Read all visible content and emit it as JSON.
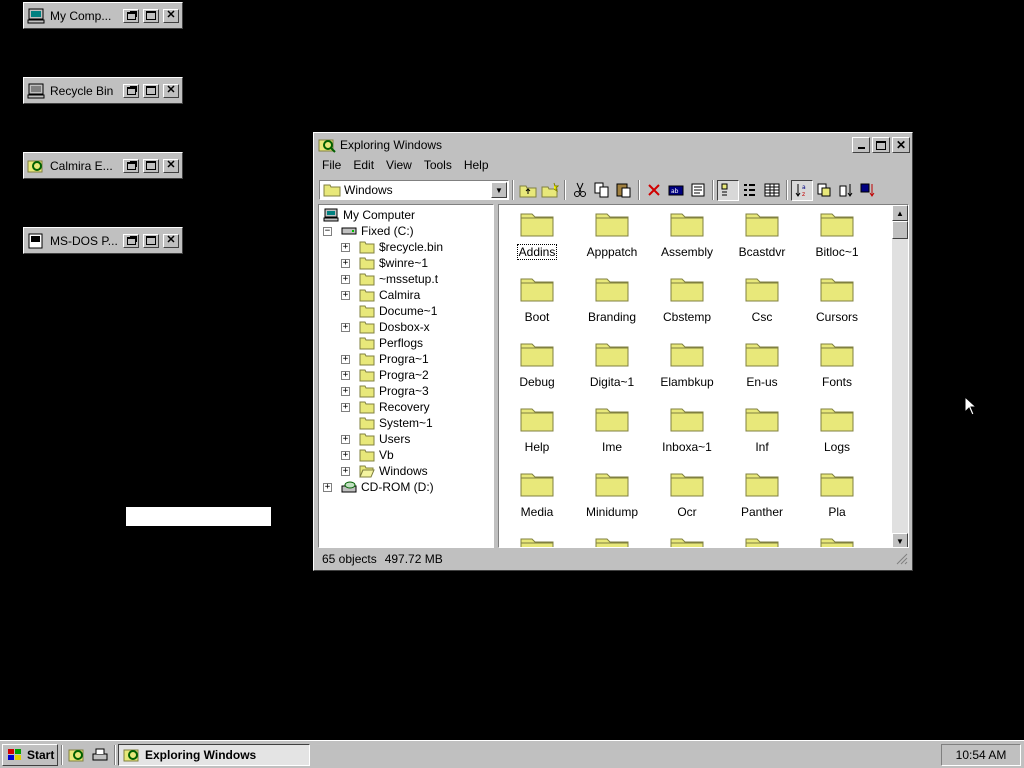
{
  "desktop": {
    "minimized_windows": [
      {
        "title": "My Comp...",
        "icon": "computer-icon"
      },
      {
        "title": "Recycle Bin",
        "icon": "recycle-bin-icon"
      },
      {
        "title": "Calmira E...",
        "icon": "explorer-icon"
      },
      {
        "title": "MS-DOS P...",
        "icon": "msdos-icon"
      }
    ]
  },
  "window": {
    "title": "Exploring Windows",
    "menu": [
      "File",
      "Edit",
      "View",
      "Tools",
      "Help"
    ],
    "location": "Windows",
    "tree": {
      "root": "My Computer",
      "drive": "Fixed (C:)",
      "folders": [
        {
          "name": "$recycle.bin",
          "expandable": true
        },
        {
          "name": "$winre~1",
          "expandable": true
        },
        {
          "name": "~mssetup.t",
          "expandable": true
        },
        {
          "name": "Calmira",
          "expandable": true
        },
        {
          "name": "Docume~1",
          "expandable": false
        },
        {
          "name": "Dosbox-x",
          "expandable": true
        },
        {
          "name": "Perflogs",
          "expandable": false
        },
        {
          "name": "Progra~1",
          "expandable": true
        },
        {
          "name": "Progra~2",
          "expandable": true
        },
        {
          "name": "Progra~3",
          "expandable": true
        },
        {
          "name": "Recovery",
          "expandable": true
        },
        {
          "name": "System~1",
          "expandable": false
        },
        {
          "name": "Users",
          "expandable": true
        },
        {
          "name": "Vb",
          "expandable": true
        },
        {
          "name": "Windows",
          "expandable": true,
          "open": true
        }
      ],
      "cdrom": "CD-ROM (D:)"
    },
    "files": [
      "Addins",
      "Apppatch",
      "Assembly",
      "Bcastdvr",
      "Bitloc~1",
      "Boot",
      "Branding",
      "Cbstemp",
      "Csc",
      "Cursors",
      "Debug",
      "Digita~1",
      "Elambkup",
      "En-us",
      "Fonts",
      "Help",
      "Ime",
      "Inboxa~1",
      "Inf",
      "Logs",
      "Media",
      "Minidump",
      "Ocr",
      "Panther",
      "Pla",
      "",
      "",
      "",
      "",
      ""
    ],
    "status": {
      "objects": "65 objects",
      "size": "497.72 MB"
    }
  },
  "taskbar": {
    "start_label": "Start",
    "active_task": "Exploring Windows",
    "clock": "10:54 AM"
  },
  "colors": {
    "folder": "#e8e87a",
    "folder_stroke": "#808040",
    "desktop": "#000000"
  }
}
